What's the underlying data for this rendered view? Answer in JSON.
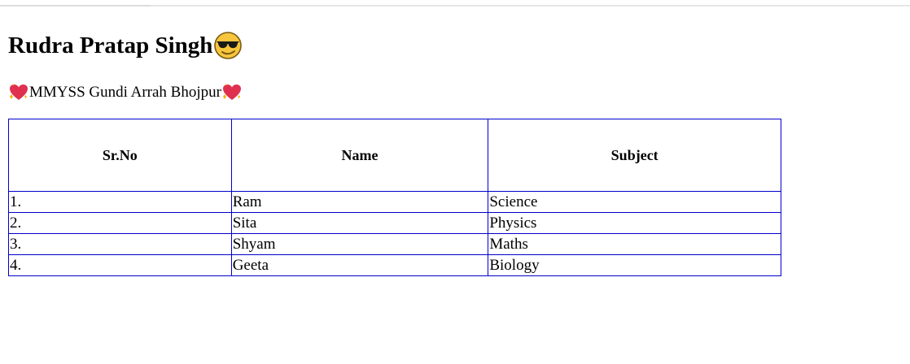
{
  "heading": {
    "title": "Rudra Pratap Singh"
  },
  "subtitle": {
    "text": "MMYSS Gundi Arrah Bhojpur"
  },
  "table": {
    "headers": [
      "Sr.No",
      "Name",
      "Subject"
    ],
    "rows": [
      [
        "1.",
        "Ram",
        "Science"
      ],
      [
        "2.",
        "Sita",
        "Physics"
      ],
      [
        "3.",
        "Shyam",
        "Maths"
      ],
      [
        "4.",
        "Geeta",
        "Biology"
      ]
    ]
  },
  "icons": {
    "title_emoji": "sunglasses-face-icon",
    "subtitle_emoji": "sparkling-heart-icon"
  },
  "colors": {
    "table_border": "#0000cc",
    "text": "#000000",
    "background": "#ffffff"
  }
}
